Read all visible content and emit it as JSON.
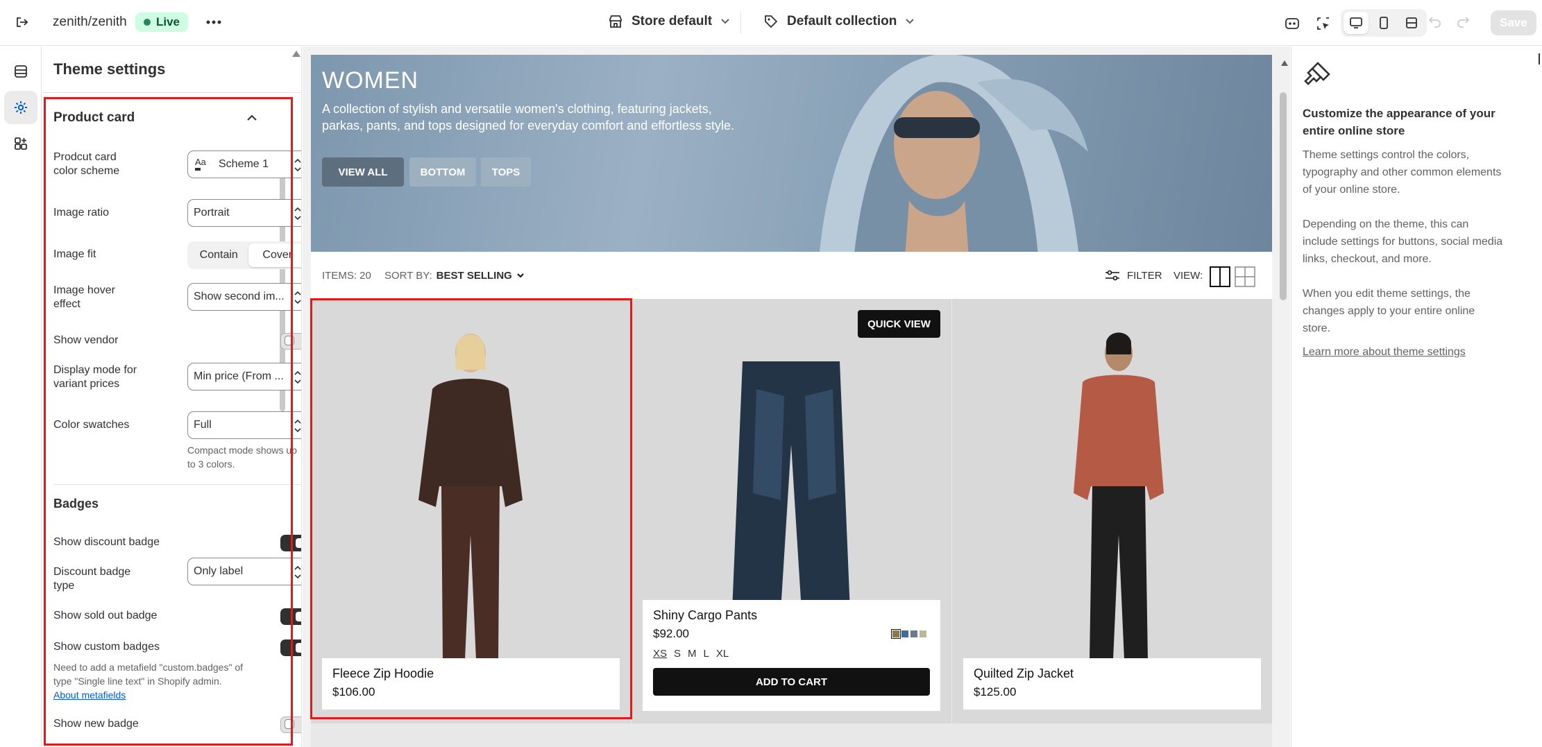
{
  "topbar": {
    "store_name": "zenith/zenith",
    "live_badge": "Live",
    "store_selector": "Store default",
    "template_selector": "Default collection",
    "save_label": "Save"
  },
  "panel": {
    "title": "Theme settings",
    "product_card": {
      "heading": "Product card",
      "color_scheme_label_1": "Prodcut card",
      "color_scheme_label_2": "color scheme",
      "color_scheme_value": "Scheme 1",
      "image_ratio_label": "Image ratio",
      "image_ratio_value": "Portrait",
      "image_fit_label": "Image fit",
      "image_fit_options": [
        "Contain",
        "Cover"
      ],
      "image_fit_selected": "Cover",
      "hover_label_1": "Image hover",
      "hover_label_2": "effect",
      "hover_value": "Show second im...",
      "show_vendor_label": "Show vendor",
      "show_vendor_on": false,
      "display_mode_label_1": "Display mode for",
      "display_mode_label_2": "variant prices",
      "display_mode_value": "Min price (From ...",
      "swatches_label": "Color swatches",
      "swatches_value": "Full",
      "swatches_help_1": "Compact mode shows up",
      "swatches_help_2": "to 3 colors."
    },
    "badges": {
      "heading": "Badges",
      "discount_label": "Show discount badge",
      "discount_on": true,
      "discount_type_label_1": "Discount badge",
      "discount_type_label_2": "type",
      "discount_type_value": "Only label",
      "sold_out_label": "Show sold out badge",
      "sold_out_on": true,
      "custom_label": "Show custom badges",
      "custom_on": true,
      "custom_help_1": "Need to add a metafield \"custom.badges\" of",
      "custom_help_2": "type \"Single line text\" in Shopify admin.",
      "custom_help_link": "About metafields",
      "new_label": "Show new badge",
      "new_on": false
    }
  },
  "preview": {
    "hero": {
      "title": "WOMEN",
      "description_1": "A collection of stylish and versatile women's clothing, featuring jackets,",
      "description_2": "parkas, pants, and tops designed for everyday comfort and effortless style.",
      "buttons": [
        "VIEW ALL",
        "BOTTOM",
        "TOPS"
      ]
    },
    "filterbar": {
      "items": "ITEMS: 20",
      "sort_prefix": "SORT BY:",
      "sort_value": "BEST SELLING",
      "filter": "FILTER",
      "view": "VIEW:"
    },
    "products": [
      {
        "name": "Fleece Zip Hoodie",
        "price": "$106.00"
      },
      {
        "name": "Shiny Cargo Pants",
        "price": "$92.00",
        "sizes": [
          "XS",
          "S",
          "M",
          "L",
          "XL"
        ],
        "button": "ADD TO CART",
        "quick_view": "QUICK VIEW",
        "swatch_colors": [
          "#8a7a4a",
          "#3d6e9a",
          "#6a7a8a",
          "#b8b89a"
        ]
      },
      {
        "name": "Quilted Zip Jacket",
        "price": "$125.00"
      }
    ]
  },
  "right_panel": {
    "title_1": "Customize the appearance of your",
    "title_2": "entire online store",
    "para1_1": "Theme settings control the colors,",
    "para1_2": "typography and other common elements",
    "para1_3": "of your online store.",
    "para2_1": "Depending on the theme, this can",
    "para2_2": "include settings for buttons, social media",
    "para2_3": "links, checkout, and more.",
    "para3_1": "When you edit theme settings, the",
    "para3_2": "changes apply to your entire online",
    "para3_3": "store.",
    "link": "Learn more about theme settings"
  },
  "colors": {
    "accent_red": "#e01b1b",
    "live_green": "#cdfee1",
    "link_blue": "#005bd3"
  }
}
